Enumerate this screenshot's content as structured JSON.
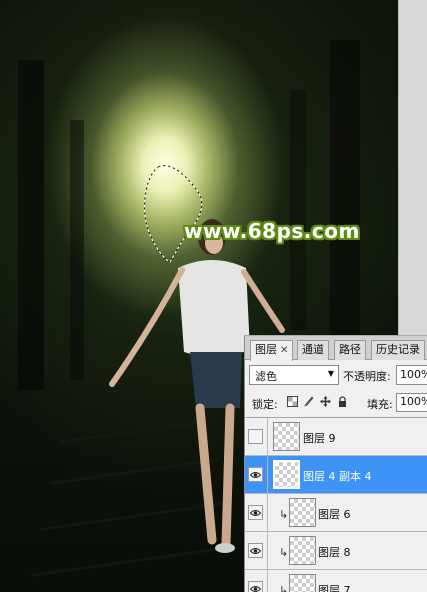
{
  "canvas": {
    "watermark": "www.68ps.com"
  },
  "layers_panel": {
    "tabs": [
      {
        "label": "图层",
        "active": true,
        "closable": true
      },
      {
        "label": "通道",
        "active": false
      },
      {
        "label": "路径",
        "active": false
      },
      {
        "label": "历史记录",
        "active": false
      }
    ],
    "blend_mode": "滤色",
    "opacity_label": "不透明度:",
    "opacity_value": "100%",
    "lock_label": "锁定:",
    "lock_icons": [
      "lock-transparent-icon",
      "lock-brush-icon",
      "lock-move-icon",
      "lock-all-icon"
    ],
    "fill_label": "填充:",
    "fill_value": "100%",
    "layers": [
      {
        "name": "图层 9",
        "visible": false,
        "selected": false,
        "clipped": false
      },
      {
        "name": "图层 4 副本 4",
        "visible": true,
        "selected": true,
        "clipped": false
      },
      {
        "name": "图层 6",
        "visible": true,
        "selected": false,
        "clipped": true
      },
      {
        "name": "图层 8",
        "visible": true,
        "selected": false,
        "clipped": true
      },
      {
        "name": "图层 7",
        "visible": true,
        "selected": false,
        "clipped": true
      }
    ]
  },
  "colors": {
    "selection_highlight": "#3d94f6",
    "watermark_outline": "#5f8a14"
  }
}
